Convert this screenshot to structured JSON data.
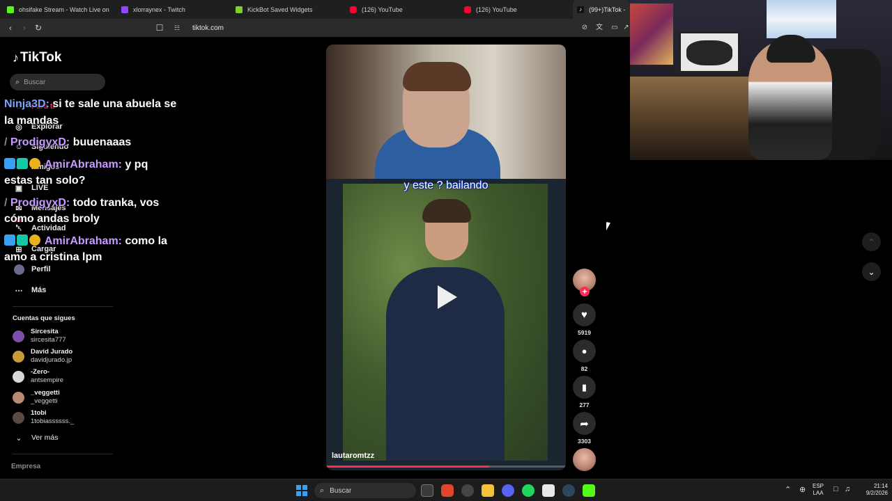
{
  "browser": {
    "tabs": [
      {
        "title": "ohsifake Stream - Watch Live on",
        "color": "#53fc18"
      },
      {
        "title": "xlorraynex - Twitch",
        "color": "#9146ff"
      },
      {
        "title": "KickBot Saved Widgets",
        "color": "#7ad12a"
      },
      {
        "title": "(126) YouTube",
        "color": "#ff0033"
      },
      {
        "title": "(126) YouTube",
        "color": "#ff0033"
      },
      {
        "title": "(99+)TikTok -",
        "color": "#ffffff"
      }
    ],
    "url": "tiktok.com"
  },
  "tiktok": {
    "logo": "TikTok",
    "search_placeholder": "Buscar",
    "nav": [
      {
        "label": "Para ti",
        "icon": "home-icon"
      },
      {
        "label": "Explorar",
        "icon": "compass-icon"
      },
      {
        "label": "Siguiendo",
        "icon": "user-check-icon"
      },
      {
        "label": "Amigos",
        "icon": "friends-icon"
      },
      {
        "label": "LIVE",
        "icon": "live-icon"
      },
      {
        "label": "Mensajes",
        "icon": "message-icon"
      },
      {
        "label": "Actividad",
        "icon": "bell-icon",
        "badge": "99+"
      },
      {
        "label": "Cargar",
        "icon": "upload-icon"
      },
      {
        "label": "Perfil",
        "icon": "avatar"
      },
      {
        "label": "Más",
        "icon": "more-dots-icon"
      }
    ],
    "following_title": "Cuentas que sigues",
    "accounts": [
      {
        "name": "Sircesita",
        "handle": "sircesita777",
        "color": "#7b4fa8"
      },
      {
        "name": "David Jurado",
        "handle": "davidjurado.jp",
        "color": "#c79b3a"
      },
      {
        "name": "-Zero-",
        "handle": "antsempire",
        "color": "#d8d8d8"
      },
      {
        "name": "_veggetti",
        "handle": "_veggetti",
        "color": "#b98a73"
      },
      {
        "name": "1tobi",
        "handle": "1tobiassssss._",
        "color": "#5a4a44"
      }
    ],
    "see_more": "Ver más",
    "footer": "Empresa"
  },
  "chat": [
    {
      "user": "Ninja3D:",
      "text": "si te sale una abuela se la mandas",
      "color": "#7aa3ff"
    },
    {
      "user": "ProdigyxD:",
      "text": "buuenaaas",
      "color": "#c89bff"
    },
    {
      "user": "AmirAbraham:",
      "text": "y pq estas tan solo?",
      "color": "#c89bff"
    },
    {
      "user": "ProdigyxD:",
      "text": "todo tranka, vos cómo andas broly",
      "color": "#c89bff"
    },
    {
      "user": "AmirAbraham:",
      "text": "como la amo a cristina lpm",
      "color": "#c89bff"
    }
  ],
  "video": {
    "caption": "y este ? bailando",
    "author": "lautaromtzz",
    "progress": 0.68,
    "likes": "5919",
    "comments": "82",
    "saves": "277",
    "shares": "3303"
  },
  "taskbar": {
    "search": "Buscar",
    "lang": "ESP",
    "layout": "LAA",
    "time": "21:14",
    "date": "9/2/2026"
  }
}
